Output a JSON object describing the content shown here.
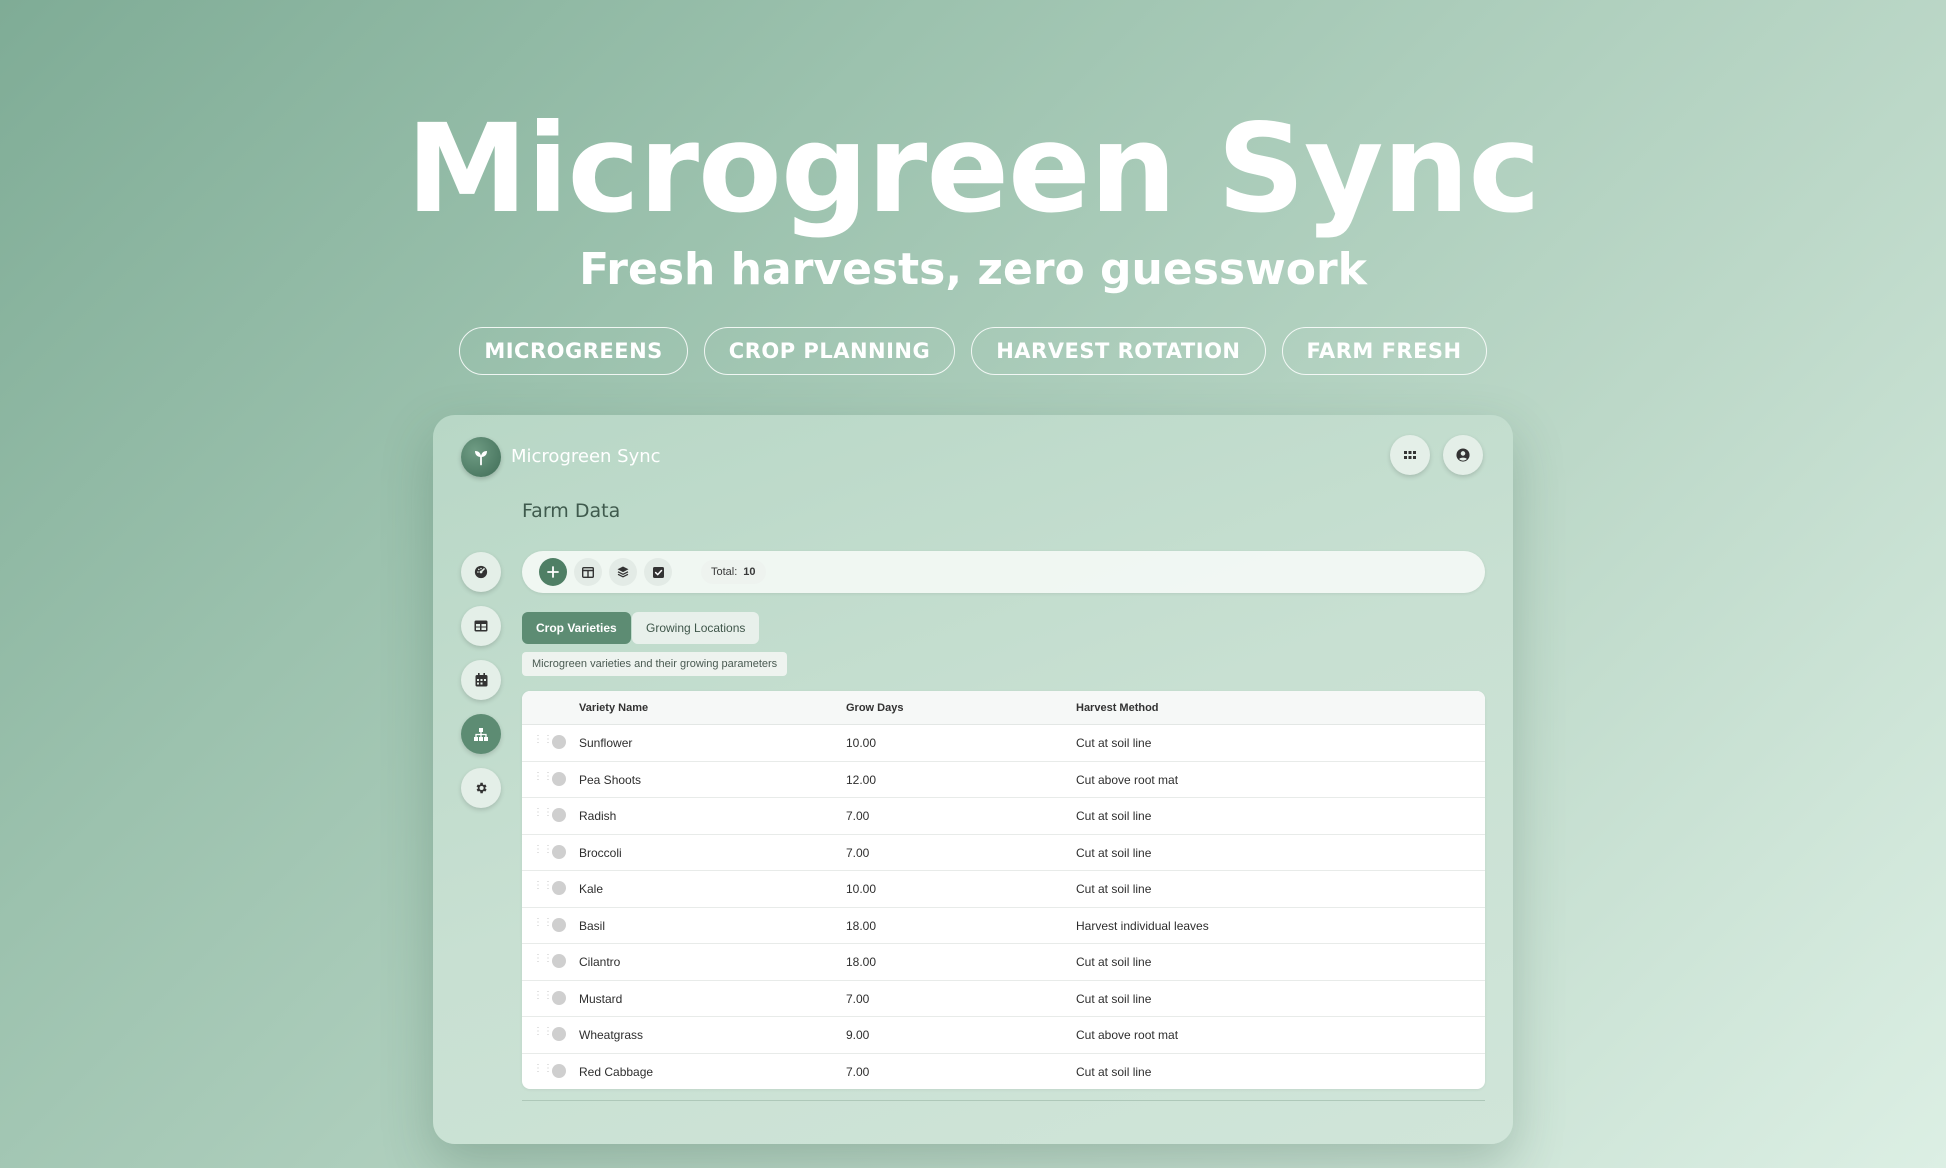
{
  "hero": {
    "title": "Microgreen Sync",
    "subtitle": "Fresh harvests, zero guesswork",
    "tags": [
      "MICROGREENS",
      "CROP PLANNING",
      "HARVEST ROTATION",
      "FARM FRESH"
    ]
  },
  "app": {
    "name": "Microgreen Sync",
    "logo_icon": "seedling-icon",
    "header_buttons": [
      "grid-icon",
      "user-icon"
    ]
  },
  "page": {
    "title": "Farm Data"
  },
  "sidebar": {
    "items": [
      {
        "icon": "dashboard-icon",
        "active": false
      },
      {
        "icon": "table-icon",
        "active": false
      },
      {
        "icon": "calendar-icon",
        "active": false
      },
      {
        "icon": "hierarchy-icon",
        "active": true
      },
      {
        "icon": "gear-icon",
        "active": false
      }
    ]
  },
  "toolbar": {
    "buttons": [
      "plus-icon",
      "columns-icon",
      "layers-icon",
      "checkbox-icon"
    ],
    "total_label": "Total:",
    "total_value": "10"
  },
  "tabs": [
    {
      "label": "Crop Varieties",
      "active": true
    },
    {
      "label": "Growing Locations",
      "active": false
    }
  ],
  "description": "Microgreen varieties and their growing parameters",
  "table": {
    "columns": [
      "Variety Name",
      "Grow Days",
      "Harvest Method"
    ],
    "rows": [
      {
        "name": "Sunflower",
        "days": "10.00",
        "method": "Cut at soil line"
      },
      {
        "name": "Pea Shoots",
        "days": "12.00",
        "method": "Cut above root mat"
      },
      {
        "name": "Radish",
        "days": "7.00",
        "method": "Cut at soil line"
      },
      {
        "name": "Broccoli",
        "days": "7.00",
        "method": "Cut at soil line"
      },
      {
        "name": "Kale",
        "days": "10.00",
        "method": "Cut at soil line"
      },
      {
        "name": "Basil",
        "days": "18.00",
        "method": "Harvest individual leaves"
      },
      {
        "name": "Cilantro",
        "days": "18.00",
        "method": "Cut at soil line"
      },
      {
        "name": "Mustard",
        "days": "7.00",
        "method": "Cut at soil line"
      },
      {
        "name": "Wheatgrass",
        "days": "9.00",
        "method": "Cut above root mat"
      },
      {
        "name": "Red Cabbage",
        "days": "7.00",
        "method": "Cut at soil line"
      }
    ]
  },
  "colors": {
    "accent": "#5d8c73",
    "accent_dark": "#4f7f65"
  }
}
